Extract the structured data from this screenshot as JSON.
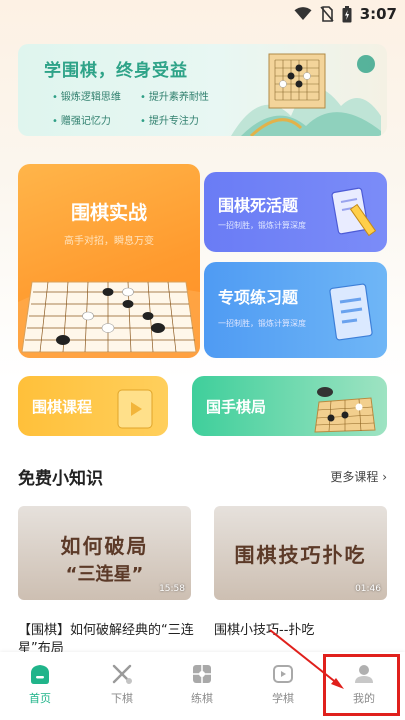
{
  "status_bar": {
    "time": "3:07"
  },
  "banner": {
    "title": "学围棋，终身受益",
    "bullets": [
      "锻炼逻辑思维",
      "提升素养耐性",
      "赠强记忆力",
      "提升专注力"
    ]
  },
  "cards": {
    "main": {
      "title": "围棋实战",
      "subtitle": "高手对招，瞬息万变"
    },
    "life_death": {
      "title": "围棋死活题",
      "subtitle": "一招制胜，锻炼计算深度"
    },
    "practice": {
      "title": "专项练习题",
      "subtitle": "一招制胜，锻炼计算深度"
    },
    "course": {
      "title": "围棋课程"
    },
    "game": {
      "title": "国手棋局"
    }
  },
  "section": {
    "title": "免费小知识",
    "more": "更多课程 ›"
  },
  "videos": [
    {
      "thumb_line1": "如何破局",
      "thumb_line2": "“三连星”",
      "duration": "15:58",
      "title": "【围棋】如何破解经典的“三连星”布局"
    },
    {
      "thumb_line1": "围棋技巧扑吃",
      "thumb_line2": "",
      "duration": "01:46",
      "title": "围棋小技巧--扑吃"
    }
  ],
  "nav": {
    "items": [
      {
        "label": "首页",
        "icon": "home-icon",
        "active": true
      },
      {
        "label": "下棋",
        "icon": "play-chess-icon",
        "active": false
      },
      {
        "label": "练棋",
        "icon": "practice-board-icon",
        "active": false
      },
      {
        "label": "学棋",
        "icon": "learn-video-icon",
        "active": false
      },
      {
        "label": "我的",
        "icon": "profile-icon",
        "active": false
      }
    ]
  },
  "colors": {
    "accent": "#20b48a",
    "highlight": "#e0201c",
    "orange": "#ff9a2e",
    "indigo": "#6a7cf5",
    "blue": "#4f9bf3"
  }
}
